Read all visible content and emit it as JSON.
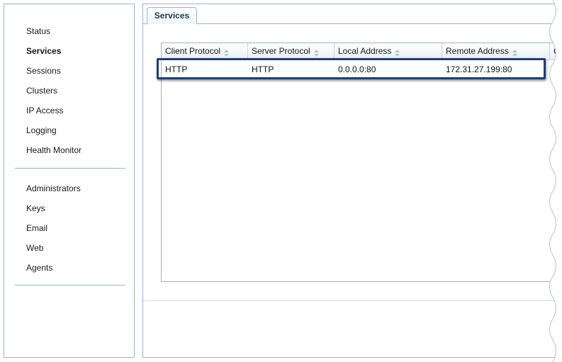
{
  "sidebar": {
    "group1": [
      {
        "label": "Status",
        "active": false
      },
      {
        "label": "Services",
        "active": true
      },
      {
        "label": "Sessions",
        "active": false
      },
      {
        "label": "Clusters",
        "active": false
      },
      {
        "label": "IP Access",
        "active": false
      },
      {
        "label": "Logging",
        "active": false
      },
      {
        "label": "Health Monitor",
        "active": false
      }
    ],
    "group2": [
      {
        "label": "Administrators"
      },
      {
        "label": "Keys"
      },
      {
        "label": "Email"
      },
      {
        "label": "Web"
      },
      {
        "label": "Agents"
      }
    ]
  },
  "tabs": [
    {
      "label": "Services",
      "active": true
    }
  ],
  "table": {
    "columns": [
      "Client Protocol",
      "Server Protocol",
      "Local Address",
      "Remote Address",
      "Cl"
    ],
    "rows": [
      [
        "HTTP",
        "HTTP",
        "0.0.0.0:80",
        "172.31.27.199:80",
        ""
      ]
    ],
    "selected_row": 0
  },
  "colors": {
    "border": "#9bb3cc",
    "highlight": "#1e4074",
    "tab_text": "#1f3552"
  },
  "icons": {
    "sort": "sort-arrows-icon"
  }
}
